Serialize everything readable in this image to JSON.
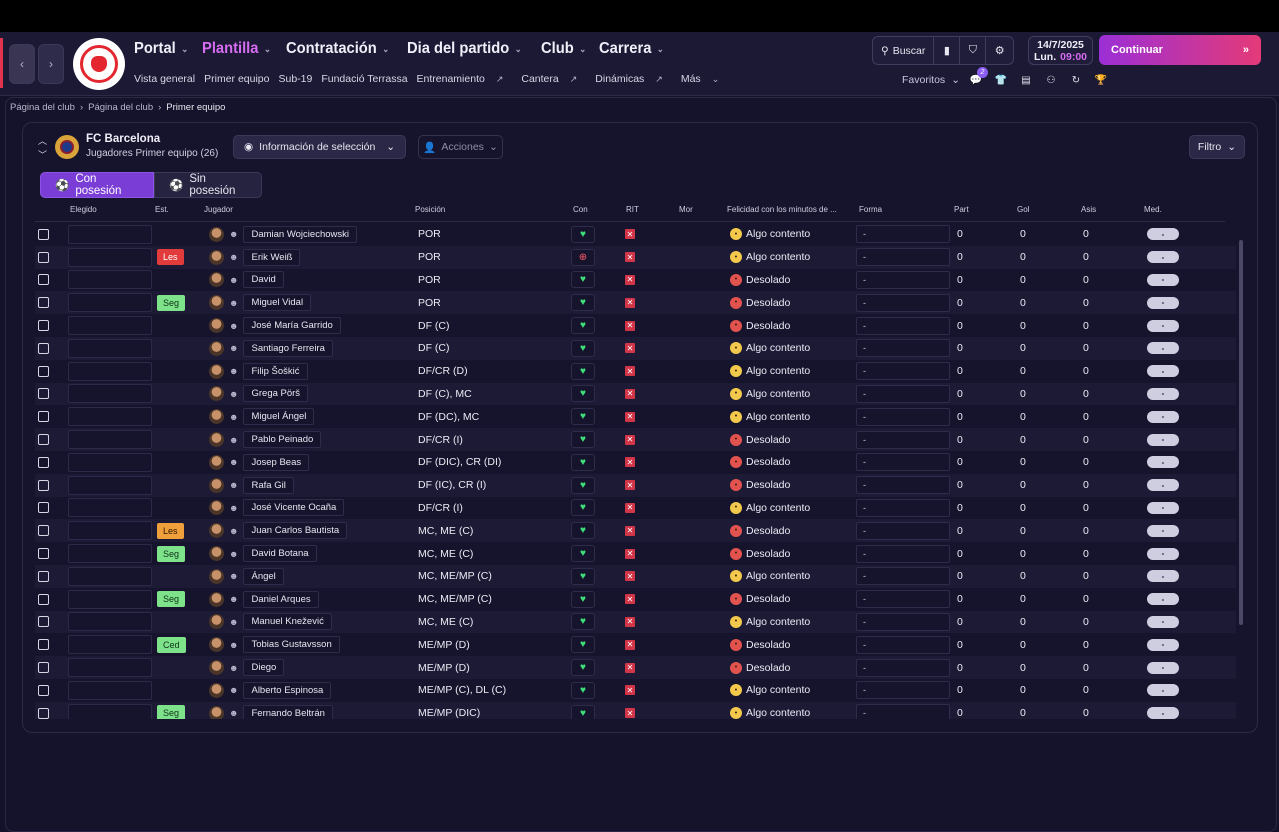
{
  "header": {
    "main_nav": [
      "Portal",
      "Plantilla",
      "Contratación",
      "Dia del partido",
      "Club",
      "Carrera"
    ],
    "sub_nav": [
      "Vista general",
      "Primer equipo",
      "Sub-19",
      "Fundació Terrassa",
      "Entrenamiento",
      "Cantera",
      "Dinámicas",
      "Más"
    ],
    "search_label": "Buscar",
    "date": "14/7/2025",
    "day": "Lun.",
    "time": "09:00",
    "continue_label": "Continuar",
    "favorites_label": "Favoritos",
    "notification_count": "2"
  },
  "breadcrumb": [
    "Página del club",
    "Página del club",
    "Primer equipo"
  ],
  "squad": {
    "club_name": "FC Barcelona",
    "subtitle": "Jugadores Primer equipo (26)",
    "info_button": "Información de selección",
    "actions_button": "Acciones",
    "filter_button": "Filtro",
    "tab_with": "Con posesión",
    "tab_without": "Sin posesión"
  },
  "columns": [
    "Elegido",
    "Est.",
    "Jugador",
    "Posición",
    "Con",
    "RIT",
    "Mor",
    "Felicidad con los minutos de ...",
    "Forma",
    "Part",
    "Gol",
    "Asis",
    "Med."
  ],
  "rows": [
    {
      "est": "",
      "player": "Damian Wojciechowski",
      "pos": "POR",
      "con": "heart",
      "happy": "Algo contento",
      "mood": "ok"
    },
    {
      "est": "Les",
      "player": "Erik Weiß",
      "pos": "POR",
      "con": "plus",
      "happy": "Algo contento",
      "mood": "ok"
    },
    {
      "est": "",
      "player": "David",
      "pos": "POR",
      "con": "heart",
      "happy": "Desolado",
      "mood": "bad"
    },
    {
      "est": "Seg",
      "player": "Miguel Vidal",
      "pos": "POR",
      "con": "heart",
      "happy": "Desolado",
      "mood": "bad"
    },
    {
      "est": "",
      "player": "José María Garrido",
      "pos": "DF (C)",
      "con": "heart",
      "happy": "Desolado",
      "mood": "bad"
    },
    {
      "est": "",
      "player": "Santiago Ferreira",
      "pos": "DF (C)",
      "con": "heart",
      "happy": "Algo contento",
      "mood": "ok"
    },
    {
      "est": "",
      "player": "Filip Šoškić",
      "pos": "DF/CR (D)",
      "con": "heart",
      "happy": "Algo contento",
      "mood": "ok"
    },
    {
      "est": "",
      "player": "Grega Pörš",
      "pos": "DF (C), MC",
      "con": "heart",
      "happy": "Algo contento",
      "mood": "ok"
    },
    {
      "est": "",
      "player": "Miguel Ángel",
      "pos": "DF (DC), MC",
      "con": "heart",
      "happy": "Algo contento",
      "mood": "ok"
    },
    {
      "est": "",
      "player": "Pablo Peinado",
      "pos": "DF/CR (I)",
      "con": "heart",
      "happy": "Desolado",
      "mood": "bad"
    },
    {
      "est": "",
      "player": "Josep Beas",
      "pos": "DF (DIC), CR (DI)",
      "con": "heart",
      "happy": "Desolado",
      "mood": "bad"
    },
    {
      "est": "",
      "player": "Rafa Gil",
      "pos": "DF (IC), CR (I)",
      "con": "heart",
      "happy": "Desolado",
      "mood": "bad"
    },
    {
      "est": "",
      "player": "José Vicente Ocaña",
      "pos": "DF/CR (I)",
      "con": "heart",
      "happy": "Algo contento",
      "mood": "ok"
    },
    {
      "est": "Les",
      "player": "Juan Carlos Bautista",
      "pos": "MC, ME (C)",
      "con": "heart",
      "happy": "Desolado",
      "mood": "bad"
    },
    {
      "est": "Seg",
      "player": "David Botana",
      "pos": "MC, ME (C)",
      "con": "heart",
      "happy": "Desolado",
      "mood": "bad"
    },
    {
      "est": "",
      "player": "Ángel",
      "pos": "MC, ME/MP (C)",
      "con": "heart",
      "happy": "Algo contento",
      "mood": "ok"
    },
    {
      "est": "Seg",
      "player": "Daniel Arques",
      "pos": "MC, ME/MP (C)",
      "con": "heart",
      "happy": "Desolado",
      "mood": "bad"
    },
    {
      "est": "",
      "player": "Manuel Knežević",
      "pos": "MC, ME (C)",
      "con": "heart",
      "happy": "Algo contento",
      "mood": "ok"
    },
    {
      "est": "Ced",
      "player": "Tobias Gustavsson",
      "pos": "ME/MP (D)",
      "con": "heart",
      "happy": "Desolado",
      "mood": "bad"
    },
    {
      "est": "",
      "player": "Diego",
      "pos": "ME/MP (D)",
      "con": "heart",
      "happy": "Desolado",
      "mood": "bad"
    },
    {
      "est": "",
      "player": "Alberto Espinosa",
      "pos": "ME/MP (C), DL (C)",
      "con": "heart",
      "happy": "Algo contento",
      "mood": "ok"
    },
    {
      "est": "Seg",
      "player": "Fernando Beltrán",
      "pos": "ME/MP (DIC)",
      "con": "heart",
      "happy": "Algo contento",
      "mood": "ok"
    }
  ],
  "row_defaults": {
    "forma": "-",
    "part": "0",
    "gol": "0",
    "asis": "0",
    "med": "-"
  }
}
